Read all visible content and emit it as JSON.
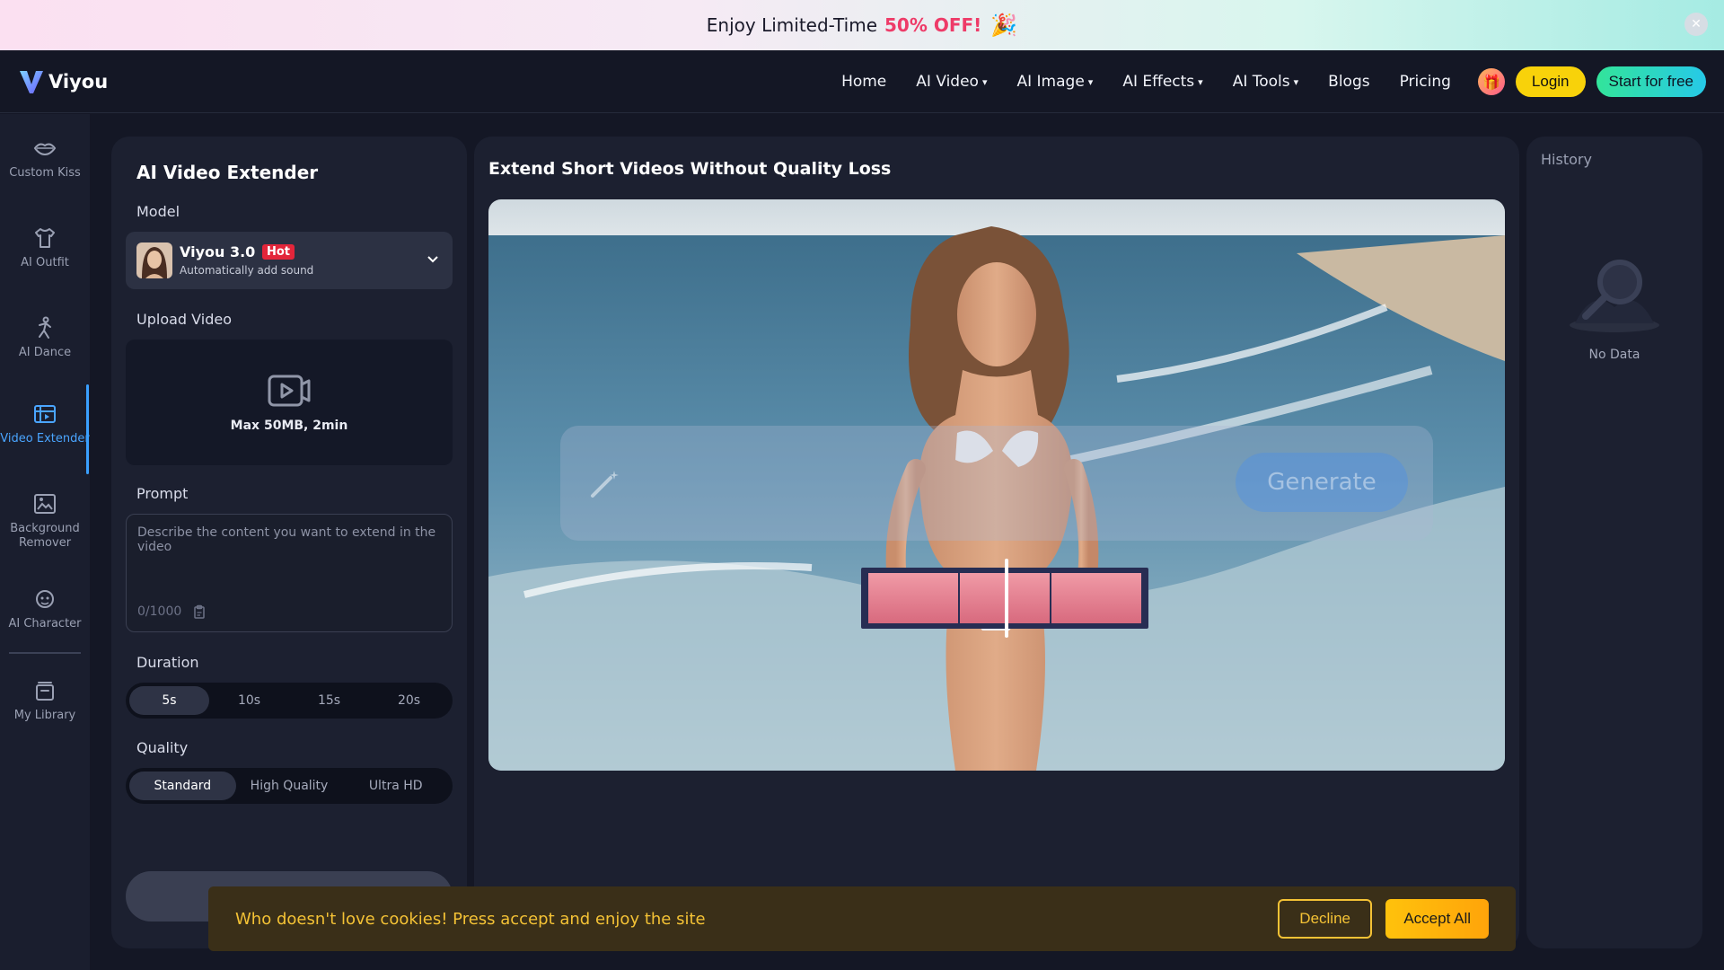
{
  "promo": {
    "text": "Enjoy Limited-Time",
    "highlight": "50% OFF!",
    "emoji": "🎉",
    "close_glyph": "✕"
  },
  "header": {
    "logo_text": "Viyou",
    "nav": [
      {
        "label": "Home",
        "dropdown": false
      },
      {
        "label": "AI Video",
        "dropdown": true
      },
      {
        "label": "AI Image",
        "dropdown": true
      },
      {
        "label": "AI Effects",
        "dropdown": true
      },
      {
        "label": "AI Tools",
        "dropdown": true
      },
      {
        "label": "Blogs",
        "dropdown": false
      },
      {
        "label": "Pricing",
        "dropdown": false
      }
    ],
    "gift_icon": "🎁",
    "login_label": "Login",
    "start_label": "Start for free"
  },
  "sidebar": {
    "items": [
      {
        "label": "Custom Kiss",
        "icon": "lips-icon"
      },
      {
        "label": "AI Outfit",
        "icon": "shirt-icon"
      },
      {
        "label": "AI Dance",
        "icon": "dance-icon"
      },
      {
        "label": "Video Extender",
        "icon": "video-extender-icon",
        "active": true
      },
      {
        "label": "Background Remover",
        "icon": "image-remove-icon"
      },
      {
        "label": "AI Character",
        "icon": "character-icon"
      },
      {
        "label": "My Library",
        "icon": "library-icon"
      }
    ]
  },
  "panel": {
    "title": "AI Video Extender",
    "model_label": "Model",
    "model": {
      "name": "Viyou 3.0",
      "badge": "Hot",
      "subtitle": "Automatically add sound"
    },
    "upload_label": "Upload Video",
    "upload_hint": "Max 50MB, 2min",
    "prompt_label": "Prompt",
    "prompt_placeholder": "Describe the content you want to extend in the video",
    "prompt_count": "0/1000",
    "duration_label": "Duration",
    "durations": [
      "5s",
      "10s",
      "15s",
      "20s"
    ],
    "duration_selected": "5s",
    "quality_label": "Quality",
    "qualities": [
      "Standard",
      "High Quality",
      "Ultra HD"
    ],
    "quality_selected": "Standard"
  },
  "main": {
    "title": "Extend Short Videos Without Quality Loss",
    "overlay_button": "Generate"
  },
  "history": {
    "title": "History",
    "empty": "No Data"
  },
  "cookie": {
    "text": "Who doesn't love cookies! Press accept and enjoy the site",
    "decline_label": "Decline",
    "accept_label": "Accept All"
  },
  "colors": {
    "accent": "#3aa0ff",
    "login": "#f8d20a",
    "hot": "#e3253a",
    "cookie_text": "#f4c235"
  }
}
